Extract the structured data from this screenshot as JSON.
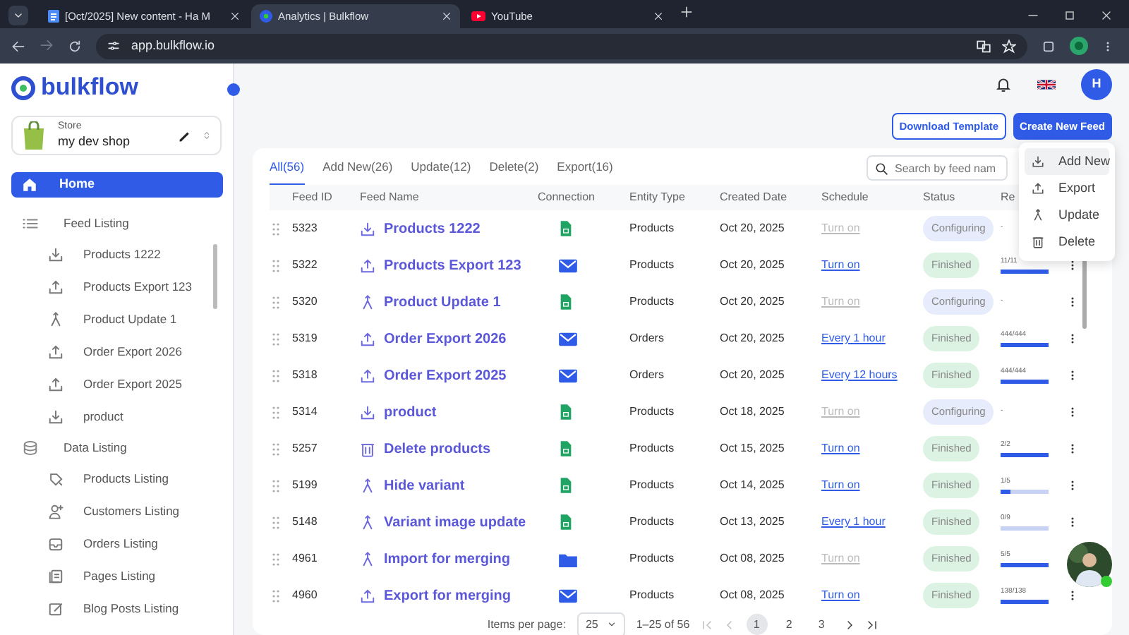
{
  "browser": {
    "tabs": [
      {
        "title": "[Oct/2025] New content - Ha M",
        "kind": "doc",
        "selected": false
      },
      {
        "title": "Analytics | Bulkflow",
        "kind": "app",
        "selected": true
      },
      {
        "title": "YouTube",
        "kind": "video",
        "selected": false
      }
    ],
    "url": "app.bulkflow.io"
  },
  "sidebar": {
    "logo": "bulkflow",
    "store": {
      "label": "Store",
      "name": "my dev shop"
    },
    "home": {
      "label": "Home",
      "selected": true
    },
    "sections": [
      {
        "label": "Feed Listing",
        "kind": "list",
        "items": [
          {
            "label": "Products 1222",
            "kind": "import"
          },
          {
            "label": "Products Export 123",
            "kind": "export"
          },
          {
            "label": "Product Update 1",
            "kind": "update"
          },
          {
            "label": "Order Export 2026",
            "kind": "export"
          },
          {
            "label": "Order Export 2025",
            "kind": "export"
          },
          {
            "label": "product",
            "kind": "import"
          }
        ]
      },
      {
        "label": "Data Listing",
        "kind": "database",
        "items": [
          {
            "label": "Products Listing",
            "kind": "tag"
          },
          {
            "label": "Customers Listing",
            "kind": "person"
          },
          {
            "label": "Orders Listing",
            "kind": "inbox"
          },
          {
            "label": "Pages Listing",
            "kind": "pages"
          },
          {
            "label": "Blog Posts Listing",
            "kind": "edit"
          }
        ]
      }
    ]
  },
  "header": {
    "avatar": "H"
  },
  "actions": {
    "download": "Download Template",
    "create": "Create New Feed"
  },
  "menu": [
    {
      "label": "Add New",
      "kind": "import",
      "selected": true
    },
    {
      "label": "Export",
      "kind": "export",
      "selected": false
    },
    {
      "label": "Update",
      "kind": "update",
      "selected": false
    },
    {
      "label": "Delete",
      "kind": "delete",
      "selected": false
    }
  ],
  "filter_tabs": [
    {
      "label": "All(56)",
      "selected": true
    },
    {
      "label": "Add New(26)",
      "selected": false
    },
    {
      "label": "Update(12)",
      "selected": false
    },
    {
      "label": "Delete(2)",
      "selected": false
    },
    {
      "label": "Export(16)",
      "selected": false
    }
  ],
  "search": {
    "placeholder": "Search by feed nam"
  },
  "table": {
    "columns": [
      "Feed ID",
      "Feed Name",
      "Connection",
      "Entity Type",
      "Created Date",
      "Schedule",
      "Status",
      "Re"
    ],
    "rows": [
      {
        "id": "5323",
        "name": "Products 1222",
        "kind": "import",
        "connection": {
          "kind": "sheet"
        },
        "entity": "Products",
        "created": "Oct 20, 2025",
        "schedule": {
          "text": "Turn on",
          "active": false
        },
        "status": {
          "text": "Configuring",
          "kind": "configuring"
        },
        "result": {
          "text": "-"
        }
      },
      {
        "id": "5322",
        "name": "Products Export 123",
        "kind": "export",
        "connection": {
          "kind": "mail"
        },
        "entity": "Products",
        "created": "Oct 20, 2025",
        "schedule": {
          "text": "Turn on",
          "active": true
        },
        "status": {
          "text": "Finished",
          "kind": "finished"
        },
        "result": {
          "text": "11/11",
          "level": 1
        }
      },
      {
        "id": "5320",
        "name": "Product Update 1",
        "kind": "update",
        "connection": {
          "kind": "sheet"
        },
        "entity": "Products",
        "created": "Oct 20, 2025",
        "schedule": {
          "text": "Turn on",
          "active": false
        },
        "status": {
          "text": "Configuring",
          "kind": "configuring"
        },
        "result": {
          "text": "-"
        }
      },
      {
        "id": "5319",
        "name": "Order Export 2026",
        "kind": "export",
        "connection": {
          "kind": "mail"
        },
        "entity": "Orders",
        "created": "Oct 20, 2025",
        "schedule": {
          "text": "Every 1 hour",
          "active": true
        },
        "status": {
          "text": "Finished",
          "kind": "finished"
        },
        "result": {
          "text": "444/444",
          "level": 1
        }
      },
      {
        "id": "5318",
        "name": "Order Export 2025",
        "kind": "export",
        "connection": {
          "kind": "mail"
        },
        "entity": "Orders",
        "created": "Oct 20, 2025",
        "schedule": {
          "text": "Every 12 hours",
          "active": true
        },
        "status": {
          "text": "Finished",
          "kind": "finished"
        },
        "result": {
          "text": "444/444",
          "level": 1
        }
      },
      {
        "id": "5314",
        "name": "product",
        "kind": "import",
        "connection": {
          "kind": "sheet"
        },
        "entity": "Products",
        "created": "Oct 18, 2025",
        "schedule": {
          "text": "Turn on",
          "active": false
        },
        "status": {
          "text": "Configuring",
          "kind": "configuring"
        },
        "result": {
          "text": "-"
        }
      },
      {
        "id": "5257",
        "name": "Delete products",
        "kind": "delete",
        "connection": {
          "kind": "sheet"
        },
        "entity": "Products",
        "created": "Oct 15, 2025",
        "schedule": {
          "text": "Turn on",
          "active": true
        },
        "status": {
          "text": "Finished",
          "kind": "finished"
        },
        "result": {
          "text": "2/2",
          "level": 1
        }
      },
      {
        "id": "5199",
        "name": "Hide variant",
        "kind": "update",
        "connection": {
          "kind": "sheet"
        },
        "entity": "Products",
        "created": "Oct 14, 2025",
        "schedule": {
          "text": "Turn on",
          "active": true
        },
        "status": {
          "text": "Finished",
          "kind": "finished"
        },
        "result": {
          "text": "1/5",
          "level": 0.2
        }
      },
      {
        "id": "5148",
        "name": "Variant image update",
        "kind": "update",
        "connection": {
          "kind": "sheet"
        },
        "entity": "Products",
        "created": "Oct 13, 2025",
        "schedule": {
          "text": "Every 1 hour",
          "active": true
        },
        "status": {
          "text": "Finished",
          "kind": "finished"
        },
        "result": {
          "text": "0/9",
          "level": 0
        }
      },
      {
        "id": "4961",
        "name": "Import for merging",
        "kind": "update",
        "connection": {
          "kind": "folder"
        },
        "entity": "Products",
        "created": "Oct 08, 2025",
        "schedule": {
          "text": "Turn on",
          "active": false
        },
        "status": {
          "text": "Finished",
          "kind": "finished"
        },
        "result": {
          "text": "5/5",
          "level": 1
        }
      },
      {
        "id": "4960",
        "name": "Export for merging",
        "kind": "export",
        "connection": {
          "kind": "mail"
        },
        "entity": "Products",
        "created": "Oct 08, 2025",
        "schedule": {
          "text": "Turn on",
          "active": true
        },
        "status": {
          "text": "Finished",
          "kind": "finished"
        },
        "result": {
          "text": "138/138",
          "level": 1
        }
      }
    ]
  },
  "pagination": {
    "label": "Items per page:",
    "size": "25",
    "range": "1–25 of 56",
    "pages": [
      {
        "label": "1",
        "selected": true
      },
      {
        "label": "2",
        "selected": false
      },
      {
        "label": "3",
        "selected": false
      }
    ]
  }
}
